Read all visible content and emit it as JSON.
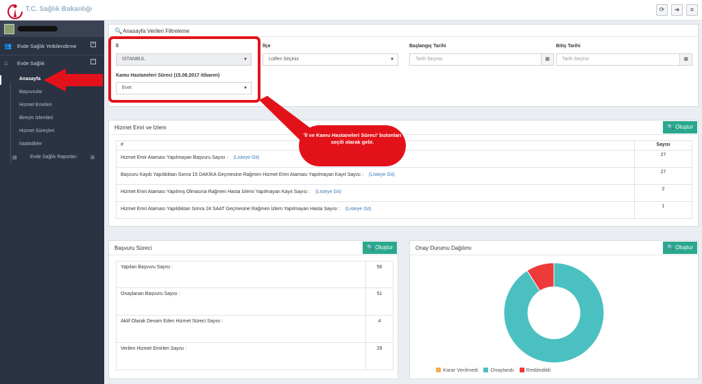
{
  "header": {
    "brand": "T.C. Sağlık Bakanlığı",
    "buttons": [
      "refresh-icon",
      "logout-icon",
      "menu-icon"
    ]
  },
  "sidebar": {
    "menus": [
      {
        "label": "Evde Sağlık Yetkilendirme",
        "icon": "users-icon"
      },
      {
        "label": "Evde Sağlık",
        "icon": "home-icon"
      }
    ],
    "subitems": [
      "Anasayfa",
      "Başvurular",
      "Hizmet Emirleri",
      "Bireyin İzlemleri",
      "Hizmet Süreçleri",
      "İstatistikler",
      "Evde Sağlık Raporları"
    ]
  },
  "filter": {
    "title": "Anasayfa Verileri Filtreleme",
    "il_label": "İl",
    "il_value": "İSTANBUL",
    "ilce_label": "İlçe",
    "ilce_value": "Lütfen Seçiniz",
    "start_label": "Başlangıç Tarihi",
    "start_placeholder": "Tarih Seçiniz",
    "end_label": "Bitiş Tarihi",
    "end_placeholder": "Tarih Seçiniz",
    "kamu_label": "Kamu Hastaneleri Süreci",
    "kamu_label_note": "(15.08.2017 itibaren)",
    "kamu_value": "Evet"
  },
  "hizmet": {
    "title": "Hizmet Emri ve İzlem",
    "button": "Oluştur",
    "col_hash": "#",
    "col_count": "Sayısı",
    "link": "(Listeye Git)",
    "rows": [
      {
        "label": "Hizmet Emir Ataması Yapılmayan Başvuru Sayısı :",
        "count": "27"
      },
      {
        "label": "Başvuru Kaydı Yapıldıktan Sonra 15 DAKİKA Geçmesine Rağmen Hizmet Emri Ataması Yapılmayan Kayıt Sayısı :",
        "count": "27"
      },
      {
        "label": "Hizmet Emri Ataması Yapılmış Olmasına Rağmen Hasta İzlemi Yapılmayan Kayıt Sayısı :",
        "count": "2"
      },
      {
        "label": "Hizmet Emri Ataması Yapıldıktan Sonra 24 SAAT Geçmesine Rağmen İzlem Yapılmayan Hasta Sayısı :",
        "count": "1"
      }
    ]
  },
  "callout": "'İl ve Kamu Hastaneleri Süreci' butonları seçili olarak gelir.",
  "basvuru": {
    "title": "Başvuru Süreci",
    "button": "Oluştur",
    "rows": [
      {
        "label": "Yapılan Başvuru Sayısı :",
        "value": "56"
      },
      {
        "label": "Onaylanan Başvuru Sayısı :",
        "value": "51"
      },
      {
        "label": "Aktif Olarak Devam Eden Hizmet Süreci Sayısı :",
        "value": "4"
      },
      {
        "label": "Verilen Hizmet Emirleri Sayısı :",
        "value": "29"
      }
    ]
  },
  "onay": {
    "title": "Onay Durumu Dağılımı",
    "button": "Oluştur"
  },
  "chart_data": {
    "type": "pie",
    "donut": true,
    "series": [
      {
        "name": "Karar Verilmedi",
        "value": 0,
        "color": "#f0ad4e"
      },
      {
        "name": "Onaylandı",
        "value": 91,
        "color": "#4bc0c0"
      },
      {
        "name": "Reddedildi",
        "value": 9,
        "color": "#ed3b3b"
      }
    ],
    "legend": "bottom"
  }
}
